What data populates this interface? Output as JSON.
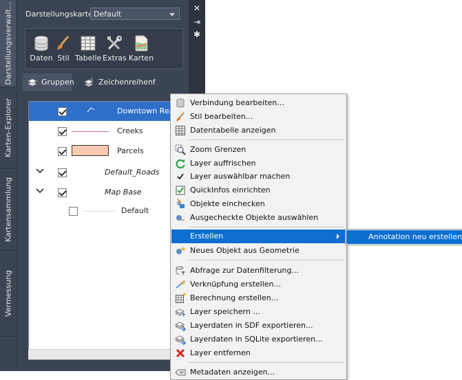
{
  "vertical_tabs": [
    "Darstellungsverwalt...",
    "Karten-Explorer",
    "Kartensammlung",
    "Vermessung"
  ],
  "map_label": "Darstellungskarte:",
  "map_value": "Default",
  "tools": [
    "Daten",
    "Stil",
    "Tabelle",
    "Extras",
    "Karten"
  ],
  "groups_label": "Gruppen",
  "draw_order_label": "Zeichenreihenf",
  "layers": [
    {
      "name": "Downtown Rea",
      "checked": true,
      "selected": true
    },
    {
      "name": "Creeks",
      "checked": true
    },
    {
      "name": "Parcels",
      "checked": true
    },
    {
      "name": "Default_Roads",
      "checked": true,
      "group": true
    },
    {
      "name": "Map Base",
      "checked": true,
      "group": true
    },
    {
      "name": "Default",
      "checked": false
    }
  ],
  "menu": {
    "items": [
      "Verbindung bearbeiten...",
      "Stil bearbeiten...",
      "Datentabelle anzeigen",
      "Zoom Grenzen",
      "Layer auffrischen",
      "Layer auswählbar machen",
      "QuickInfos einrichten",
      "Objekte einchecken",
      "Ausgecheckte Objekte auswählen",
      "Erstellen",
      "Neues Objekt aus Geometrie",
      "Abfrage zur Datenfilterung...",
      "Verknüpfung erstellen...",
      "Berechnung erstellen...",
      "Layer speichern ...",
      "Layerdaten in SDF exportieren...",
      "Layerdaten in SQLite exportieren...",
      "Layer entfernen",
      "Metadaten anzeigen..."
    ],
    "submenu_item": "Annotation neu erstellen"
  },
  "colors": {
    "accent": "#0d6fd1",
    "panel_bg": "#3b4453",
    "parcels_fill": "#f9cbb0",
    "creeks_line": "#d46a7e"
  }
}
